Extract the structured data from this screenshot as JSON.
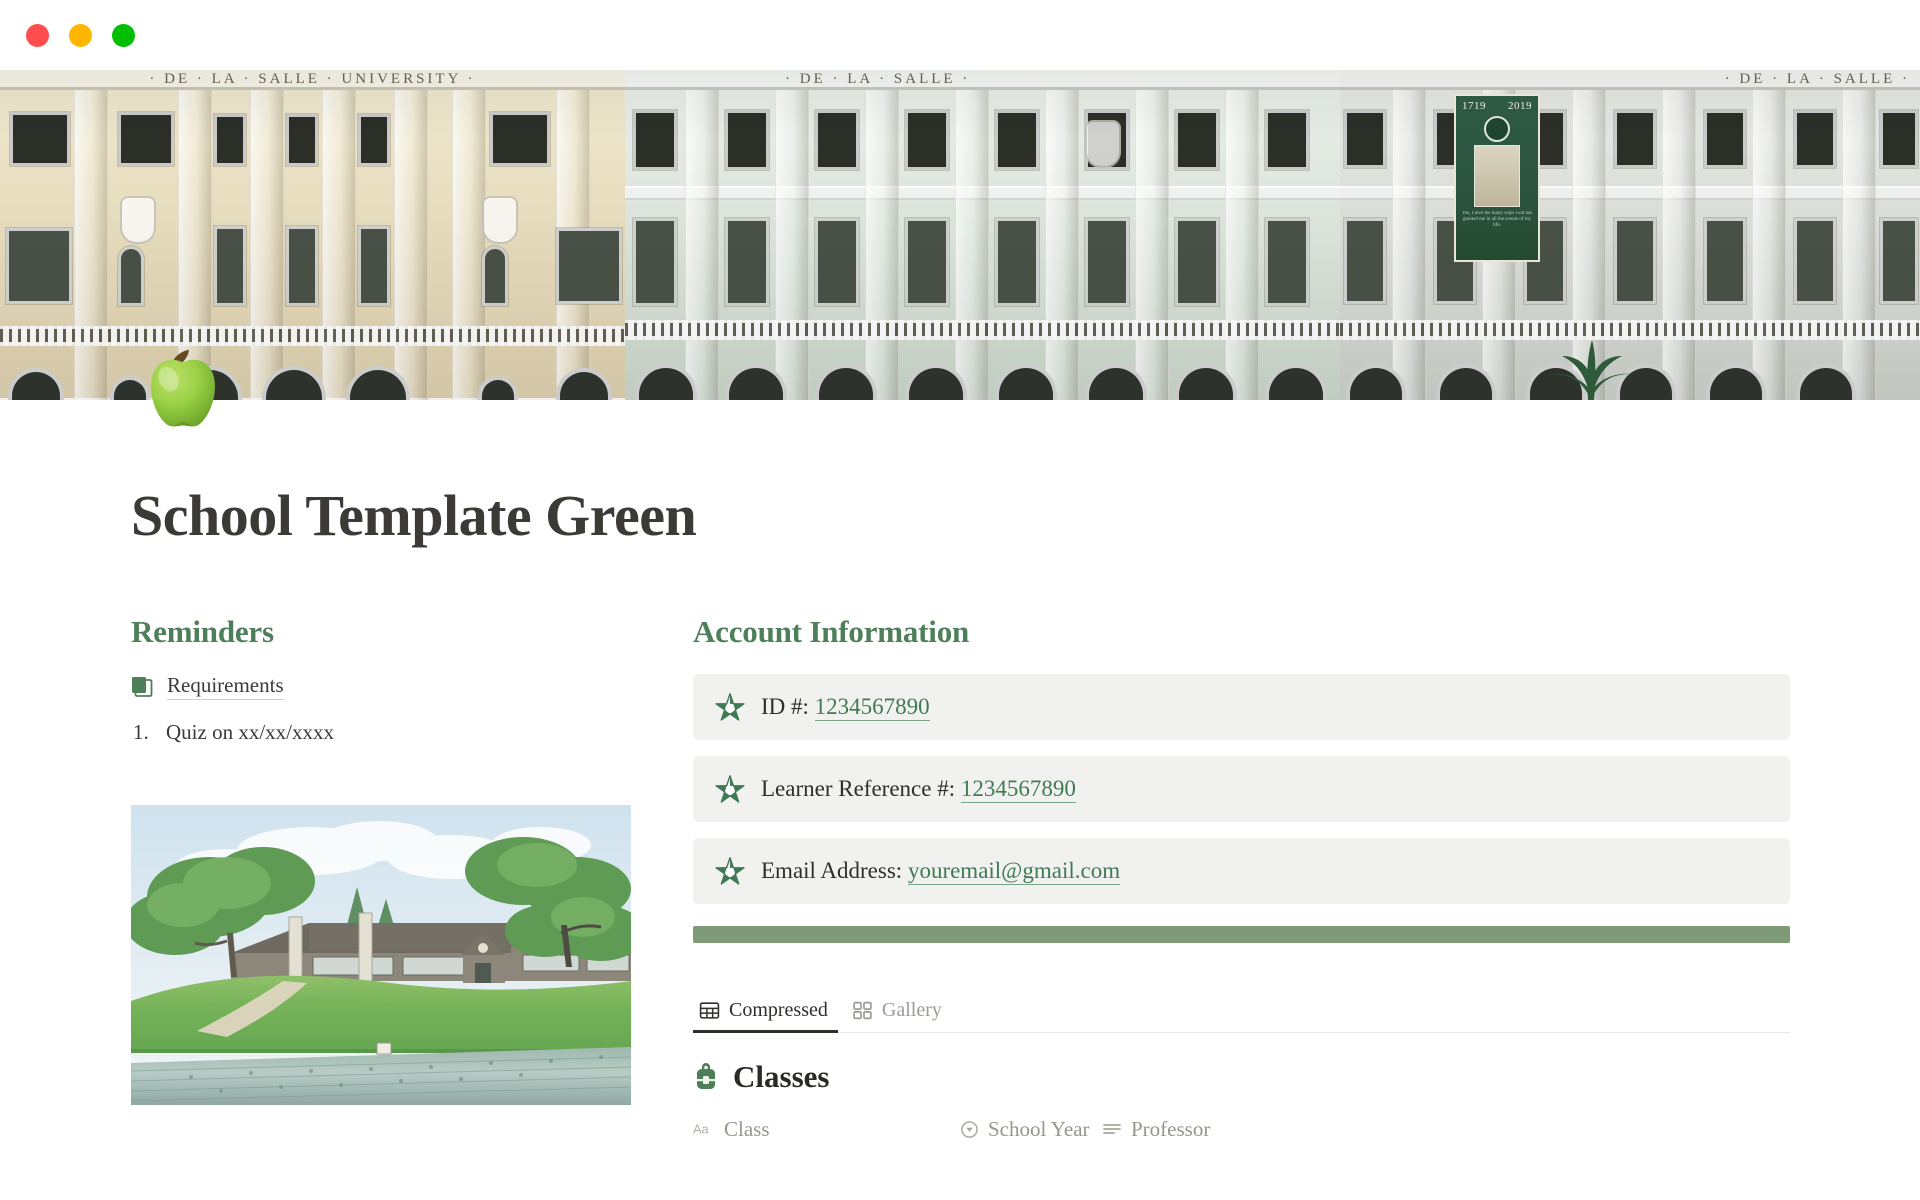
{
  "window": {
    "traffic_lights": [
      {
        "name": "close",
        "color": "#ff4d4d"
      },
      {
        "name": "minimize",
        "color": "#ffb600"
      },
      {
        "name": "maximize",
        "color": "#00bf00"
      }
    ]
  },
  "cover": {
    "alt": "De La Salle University facade photograph",
    "university_label": "· DE · LA · SALLE · UNIVERSITY ·",
    "university_label_short": "· DE · LA · SALLE ·",
    "banner": {
      "year_start": "1719",
      "year_end": "2019",
      "quote": "Yes, I love the many ways God has granted me in all the events of my life."
    }
  },
  "page": {
    "icon": "green-apple-emoji",
    "title": "School Template Green"
  },
  "reminders": {
    "heading": "Reminders",
    "page_link": {
      "icon": "notion-page-icon",
      "label": "Requirements"
    },
    "numbered_items": [
      {
        "number": "1.",
        "text": "Quiz on xx/xx/xxxx"
      }
    ],
    "illustration_alt": "Watercolor illustration of a rural school beside rice paddies"
  },
  "account_information": {
    "heading": "Account Information",
    "rows": [
      {
        "icon": "green-star-icon",
        "label": "ID #:",
        "value": "1234567890"
      },
      {
        "icon": "green-star-icon",
        "label": "Learner Reference #:",
        "value": "1234567890"
      },
      {
        "icon": "green-star-icon",
        "label": "Email Address:",
        "value": "youremail@gmail.com"
      }
    ],
    "divider_color": "#7e9a76"
  },
  "database": {
    "views": [
      {
        "icon": "table-icon",
        "label": "Compressed",
        "active": true
      },
      {
        "icon": "gallery-icon",
        "label": "Gallery",
        "active": false
      }
    ],
    "title": {
      "icon": "green-backpack-icon",
      "name": "Classes"
    },
    "columns": [
      {
        "icon": "title-text-icon",
        "label": "Class"
      },
      {
        "icon": "select-icon",
        "label": "School Year"
      },
      {
        "icon": "text-lines-icon",
        "label": "Professor"
      }
    ]
  },
  "colors": {
    "heading_green": "#4d7f5a",
    "link_green": "#3f7a55",
    "divider_green": "#7e9a76",
    "row_background": "#f1f1ef",
    "body_text": "#3b3a36"
  }
}
